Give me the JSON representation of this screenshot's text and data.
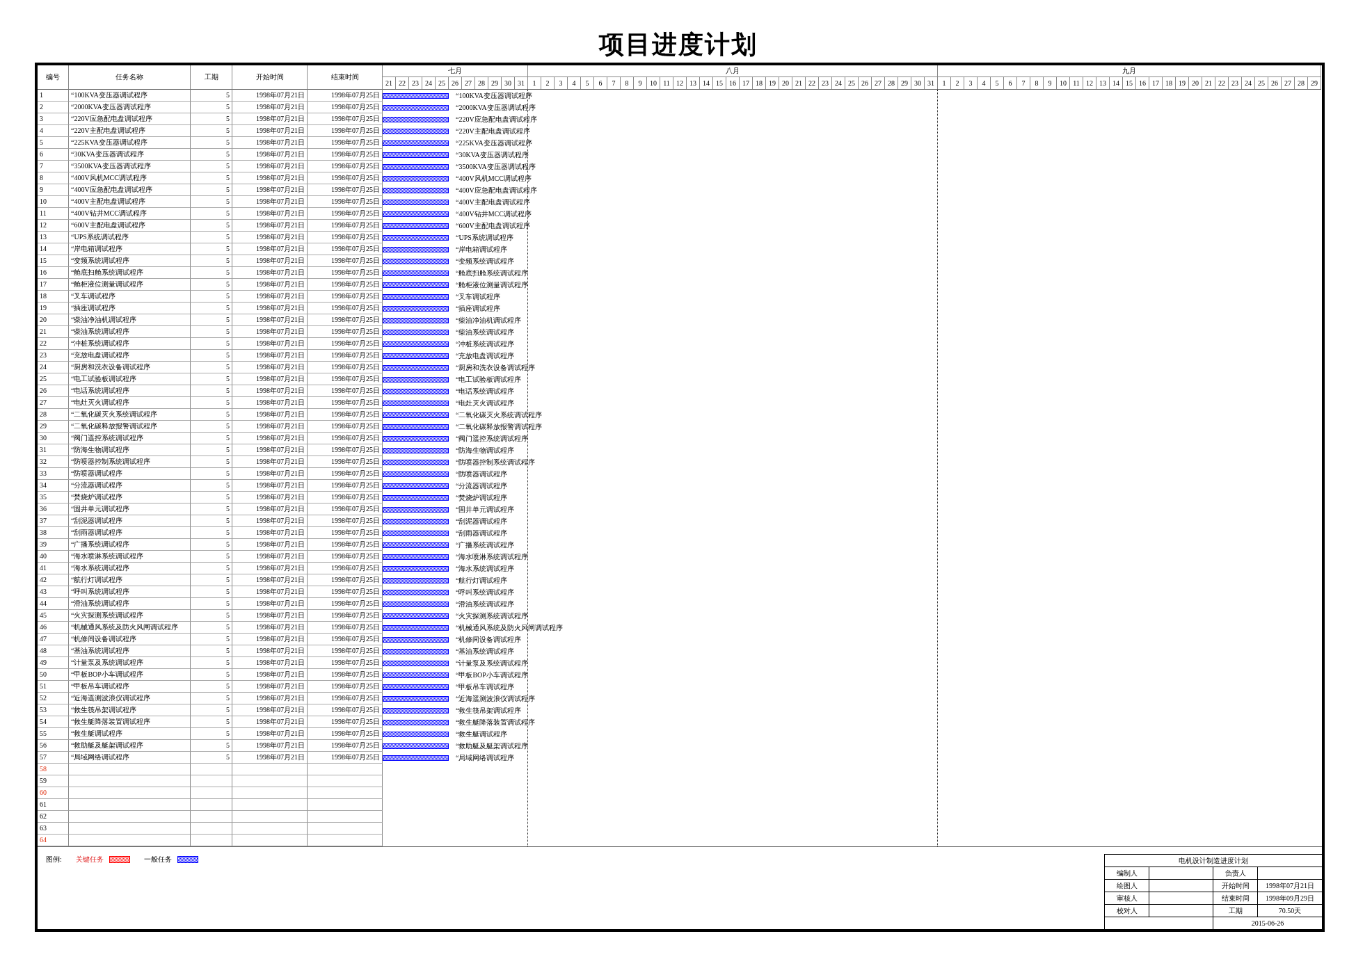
{
  "title": "项目进度计划",
  "columns": [
    "编号",
    "任务名称",
    "工期",
    "开始时间",
    "结束时间"
  ],
  "months": [
    {
      "label": "七月",
      "days": [
        "21",
        "22",
        "23",
        "24",
        "25",
        "26",
        "27",
        "28",
        "29",
        "30",
        "31"
      ]
    },
    {
      "label": "八月",
      "days": [
        "1",
        "2",
        "3",
        "4",
        "5",
        "6",
        "7",
        "8",
        "9",
        "10",
        "11",
        "12",
        "13",
        "14",
        "15",
        "16",
        "17",
        "18",
        "19",
        "20",
        "21",
        "22",
        "23",
        "24",
        "25",
        "26",
        "27",
        "28",
        "29",
        "30",
        "31"
      ]
    },
    {
      "label": "九月",
      "days": [
        "1",
        "2",
        "3",
        "4",
        "5",
        "6",
        "7",
        "8",
        "9",
        "10",
        "11",
        "12",
        "13",
        "14",
        "15",
        "16",
        "17",
        "18",
        "19",
        "20",
        "21",
        "22",
        "23",
        "24",
        "25",
        "26",
        "27",
        "28",
        "29"
      ]
    }
  ],
  "tasks": [
    {
      "no": "1",
      "name": "“100KVA变压器调试程序",
      "duration": "5",
      "start": "1998年07月21日",
      "end": "1998年07月25日",
      "bar_label": "“100KVA变压器调试程序",
      "critical": false
    },
    {
      "no": "2",
      "name": "“2000KVA变压器调试程序",
      "duration": "5",
      "start": "1998年07月21日",
      "end": "1998年07月25日",
      "bar_label": "“2000KVA变压器调试程序",
      "critical": false
    },
    {
      "no": "3",
      "name": "“220V应急配电盘调试程序",
      "duration": "5",
      "start": "1998年07月21日",
      "end": "1998年07月25日",
      "bar_label": "“220V应急配电盘调试程序",
      "critical": false
    },
    {
      "no": "4",
      "name": "“220V主配电盘调试程序",
      "duration": "5",
      "start": "1998年07月21日",
      "end": "1998年07月25日",
      "bar_label": "“220V主配电盘调试程序",
      "critical": false
    },
    {
      "no": "5",
      "name": "“225KVA变压器调试程序",
      "duration": "5",
      "start": "1998年07月21日",
      "end": "1998年07月25日",
      "bar_label": "“225KVA变压器调试程序",
      "critical": false
    },
    {
      "no": "6",
      "name": "“30KVA变压器调试程序",
      "duration": "5",
      "start": "1998年07月21日",
      "end": "1998年07月25日",
      "bar_label": "“30KVA变压器调试程序",
      "critical": false
    },
    {
      "no": "7",
      "name": "“3500KVA变压器调试程序",
      "duration": "5",
      "start": "1998年07月21日",
      "end": "1998年07月25日",
      "bar_label": "“3500KVA变压器调试程序",
      "critical": false
    },
    {
      "no": "8",
      "name": "“400V风机MCC调试程序",
      "duration": "5",
      "start": "1998年07月21日",
      "end": "1998年07月25日",
      "bar_label": "“400V风机MCC调试程序",
      "critical": false
    },
    {
      "no": "9",
      "name": "“400V应急配电盘调试程序",
      "duration": "5",
      "start": "1998年07月21日",
      "end": "1998年07月25日",
      "bar_label": "“400V应急配电盘调试程序",
      "critical": false
    },
    {
      "no": "10",
      "name": "“400V主配电盘调试程序",
      "duration": "5",
      "start": "1998年07月21日",
      "end": "1998年07月25日",
      "bar_label": "“400V主配电盘调试程序",
      "critical": false
    },
    {
      "no": "11",
      "name": "“400V钻井MCC调试程序",
      "duration": "5",
      "start": "1998年07月21日",
      "end": "1998年07月25日",
      "bar_label": "“400V钻井MCC调试程序",
      "critical": false
    },
    {
      "no": "12",
      "name": "“600V主配电盘调试程序",
      "duration": "5",
      "start": "1998年07月21日",
      "end": "1998年07月25日",
      "bar_label": "“600V主配电盘调试程序",
      "critical": false
    },
    {
      "no": "13",
      "name": "“UPS系统调试程序",
      "duration": "5",
      "start": "1998年07月21日",
      "end": "1998年07月25日",
      "bar_label": "“UPS系统调试程序",
      "critical": false
    },
    {
      "no": "14",
      "name": "“岸电箱调试程序",
      "duration": "5",
      "start": "1998年07月21日",
      "end": "1998年07月25日",
      "bar_label": "“岸电箱调试程序",
      "critical": false
    },
    {
      "no": "15",
      "name": "“变频系统调试程序",
      "duration": "5",
      "start": "1998年07月21日",
      "end": "1998年07月25日",
      "bar_label": "“变频系统调试程序",
      "critical": false
    },
    {
      "no": "16",
      "name": "“舱底扫舱系统调试程序",
      "duration": "5",
      "start": "1998年07月21日",
      "end": "1998年07月25日",
      "bar_label": "“舱底扫舱系统调试程序",
      "critical": false
    },
    {
      "no": "17",
      "name": "“舱柜液位测量调试程序",
      "duration": "5",
      "start": "1998年07月21日",
      "end": "1998年07月25日",
      "bar_label": "“舱柜液位测量调试程序",
      "critical": false
    },
    {
      "no": "18",
      "name": "“叉车调试程序",
      "duration": "5",
      "start": "1998年07月21日",
      "end": "1998年07月25日",
      "bar_label": "“叉车调试程序",
      "critical": false
    },
    {
      "no": "19",
      "name": "“插座调试程序",
      "duration": "5",
      "start": "1998年07月21日",
      "end": "1998年07月25日",
      "bar_label": "“插座调试程序",
      "critical": false
    },
    {
      "no": "20",
      "name": "“柴油净油机调试程序",
      "duration": "5",
      "start": "1998年07月21日",
      "end": "1998年07月25日",
      "bar_label": "“柴油净油机调试程序",
      "critical": false
    },
    {
      "no": "21",
      "name": "“柴油系统调试程序",
      "duration": "5",
      "start": "1998年07月21日",
      "end": "1998年07月25日",
      "bar_label": "“柴油系统调试程序",
      "critical": false
    },
    {
      "no": "22",
      "name": "“冲桩系统调试程序",
      "duration": "5",
      "start": "1998年07月21日",
      "end": "1998年07月25日",
      "bar_label": "“冲桩系统调试程序",
      "critical": false
    },
    {
      "no": "23",
      "name": "“充放电盘调试程序",
      "duration": "5",
      "start": "1998年07月21日",
      "end": "1998年07月25日",
      "bar_label": "“充放电盘调试程序",
      "critical": false
    },
    {
      "no": "24",
      "name": "“厨房和洗衣设备调试程序",
      "duration": "5",
      "start": "1998年07月21日",
      "end": "1998年07月25日",
      "bar_label": "“厨房和洗衣设备调试程序",
      "critical": false
    },
    {
      "no": "25",
      "name": "“电工试验板调试程序",
      "duration": "5",
      "start": "1998年07月21日",
      "end": "1998年07月25日",
      "bar_label": "“电工试验板调试程序",
      "critical": false
    },
    {
      "no": "26",
      "name": "“电话系统调试程序",
      "duration": "5",
      "start": "1998年07月21日",
      "end": "1998年07月25日",
      "bar_label": "“电话系统调试程序",
      "critical": false
    },
    {
      "no": "27",
      "name": "“电灶灭火调试程序",
      "duration": "5",
      "start": "1998年07月21日",
      "end": "1998年07月25日",
      "bar_label": "“电灶灭火调试程序",
      "critical": false
    },
    {
      "no": "28",
      "name": "“二氧化碳灭火系统调试程序",
      "duration": "5",
      "start": "1998年07月21日",
      "end": "1998年07月25日",
      "bar_label": "“二氧化碳灭火系统调试程序",
      "critical": false
    },
    {
      "no": "29",
      "name": "“二氧化碳释放报警调试程序",
      "duration": "5",
      "start": "1998年07月21日",
      "end": "1998年07月25日",
      "bar_label": "“二氧化碳释放报警调试程序",
      "critical": false
    },
    {
      "no": "30",
      "name": "“阀门遥控系统调试程序",
      "duration": "5",
      "start": "1998年07月21日",
      "end": "1998年07月25日",
      "bar_label": "“阀门遥控系统调试程序",
      "critical": false
    },
    {
      "no": "31",
      "name": "“防海生物调试程序",
      "duration": "5",
      "start": "1998年07月21日",
      "end": "1998年07月25日",
      "bar_label": "“防海生物调试程序",
      "critical": false
    },
    {
      "no": "32",
      "name": "“防喷器控制系统调试程序",
      "duration": "5",
      "start": "1998年07月21日",
      "end": "1998年07月25日",
      "bar_label": "“防喷器控制系统调试程序",
      "critical": false
    },
    {
      "no": "33",
      "name": "“防喷器调试程序",
      "duration": "5",
      "start": "1998年07月21日",
      "end": "1998年07月25日",
      "bar_label": "“防喷器调试程序",
      "critical": false
    },
    {
      "no": "34",
      "name": "“分流器调试程序",
      "duration": "5",
      "start": "1998年07月21日",
      "end": "1998年07月25日",
      "bar_label": "“分流器调试程序",
      "critical": false
    },
    {
      "no": "35",
      "name": "“焚烧炉调试程序",
      "duration": "5",
      "start": "1998年07月21日",
      "end": "1998年07月25日",
      "bar_label": "“焚烧炉调试程序",
      "critical": false
    },
    {
      "no": "36",
      "name": "“固井单元调试程序",
      "duration": "5",
      "start": "1998年07月21日",
      "end": "1998年07月25日",
      "bar_label": "“固井单元调试程序",
      "critical": false
    },
    {
      "no": "37",
      "name": "“刮泥器调试程序",
      "duration": "5",
      "start": "1998年07月21日",
      "end": "1998年07月25日",
      "bar_label": "“刮泥器调试程序",
      "critical": false
    },
    {
      "no": "38",
      "name": "“刮雨器调试程序",
      "duration": "5",
      "start": "1998年07月21日",
      "end": "1998年07月25日",
      "bar_label": "“刮雨器调试程序",
      "critical": false
    },
    {
      "no": "39",
      "name": "“广播系统调试程序",
      "duration": "5",
      "start": "1998年07月21日",
      "end": "1998年07月25日",
      "bar_label": "“广播系统调试程序",
      "critical": false
    },
    {
      "no": "40",
      "name": "“海水喷淋系统调试程序",
      "duration": "5",
      "start": "1998年07月21日",
      "end": "1998年07月25日",
      "bar_label": "“海水喷淋系统调试程序",
      "critical": false
    },
    {
      "no": "41",
      "name": "“海水系统调试程序",
      "duration": "5",
      "start": "1998年07月21日",
      "end": "1998年07月25日",
      "bar_label": "“海水系统调试程序",
      "critical": false
    },
    {
      "no": "42",
      "name": "“航行灯调试程序",
      "duration": "5",
      "start": "1998年07月21日",
      "end": "1998年07月25日",
      "bar_label": "“航行灯调试程序",
      "critical": false
    },
    {
      "no": "43",
      "name": "“呼叫系统调试程序",
      "duration": "5",
      "start": "1998年07月21日",
      "end": "1998年07月25日",
      "bar_label": "“呼叫系统调试程序",
      "critical": false
    },
    {
      "no": "44",
      "name": "“滑油系统调试程序",
      "duration": "5",
      "start": "1998年07月21日",
      "end": "1998年07月25日",
      "bar_label": "“滑油系统调试程序",
      "critical": false
    },
    {
      "no": "45",
      "name": "“火灾探测系统调试程序",
      "duration": "5",
      "start": "1998年07月21日",
      "end": "1998年07月25日",
      "bar_label": "“火灾探测系统调试程序",
      "critical": false
    },
    {
      "no": "46",
      "name": "“机械通风系统及防火风闸调试程序",
      "duration": "5",
      "start": "1998年07月21日",
      "end": "1998年07月25日",
      "bar_label": "“机械通风系统及防火风闸调试程序",
      "critical": false
    },
    {
      "no": "47",
      "name": "“机修间设备调试程序",
      "duration": "5",
      "start": "1998年07月21日",
      "end": "1998年07月25日",
      "bar_label": "“机修间设备调试程序",
      "critical": false
    },
    {
      "no": "48",
      "name": "“基油系统调试程序",
      "duration": "5",
      "start": "1998年07月21日",
      "end": "1998年07月25日",
      "bar_label": "“基油系统调试程序",
      "critical": false
    },
    {
      "no": "49",
      "name": "“计量泵及系统调试程序",
      "duration": "5",
      "start": "1998年07月21日",
      "end": "1998年07月25日",
      "bar_label": "“计量泵及系统调试程序",
      "critical": false
    },
    {
      "no": "50",
      "name": "“甲板BOP小车调试程序",
      "duration": "5",
      "start": "1998年07月21日",
      "end": "1998年07月25日",
      "bar_label": "“甲板BOP小车调试程序",
      "critical": false
    },
    {
      "no": "51",
      "name": "“甲板吊车调试程序",
      "duration": "5",
      "start": "1998年07月21日",
      "end": "1998年07月25日",
      "bar_label": "“甲板吊车调试程序",
      "critical": false
    },
    {
      "no": "52",
      "name": "“近海遥测波浪仪调试程序",
      "duration": "5",
      "start": "1998年07月21日",
      "end": "1998年07月25日",
      "bar_label": "“近海遥测波浪仪调试程序",
      "critical": false
    },
    {
      "no": "53",
      "name": "“救生筏吊架调试程序",
      "duration": "5",
      "start": "1998年07月21日",
      "end": "1998年07月25日",
      "bar_label": "“救生筏吊架调试程序",
      "critical": false
    },
    {
      "no": "54",
      "name": "“救生艇降落装置调试程序",
      "duration": "5",
      "start": "1998年07月21日",
      "end": "1998年07月25日",
      "bar_label": "“救生艇降落装置调试程序",
      "critical": false
    },
    {
      "no": "55",
      "name": "“救生艇调试程序",
      "duration": "5",
      "start": "1998年07月21日",
      "end": "1998年07月25日",
      "bar_label": "“救生艇调试程序",
      "critical": false
    },
    {
      "no": "56",
      "name": "“救助艇及艇架调试程序",
      "duration": "5",
      "start": "1998年07月21日",
      "end": "1998年07月25日",
      "bar_label": "“救助艇及艇架调试程序",
      "critical": false
    },
    {
      "no": "57",
      "name": "“局域网络调试程序",
      "duration": "5",
      "start": "1998年07月21日",
      "end": "1998年07月25日",
      "bar_label": "“局域网络调试程序",
      "critical": false
    }
  ],
  "empty_rows": [
    {
      "no": "58",
      "highlighted": true
    },
    {
      "no": "59",
      "highlighted": false
    },
    {
      "no": "60",
      "highlighted": true
    },
    {
      "no": "61",
      "highlighted": false
    },
    {
      "no": "62",
      "highlighted": false
    },
    {
      "no": "63",
      "highlighted": false
    },
    {
      "no": "64",
      "highlighted": true
    }
  ],
  "legend": {
    "title": "图例:",
    "items": [
      {
        "label": "关键任务",
        "critical": true
      },
      {
        "label": "一般任务",
        "critical": false
      }
    ]
  },
  "info_box": {
    "title": "电机设计制造进度计划",
    "rows": [
      {
        "label_1": "编制人",
        "label_2": "负责人"
      },
      {
        "label_1": "绘图人",
        "label_2": "开始时间",
        "value_2": "1998年07月21日"
      },
      {
        "label_1": "审核人",
        "label_2": "结束时间",
        "value_2": "1998年09月29日"
      },
      {
        "label_1": "校对人",
        "label_2": "工期",
        "value_2": "70.50天"
      }
    ],
    "date": "2015-06-26"
  }
}
